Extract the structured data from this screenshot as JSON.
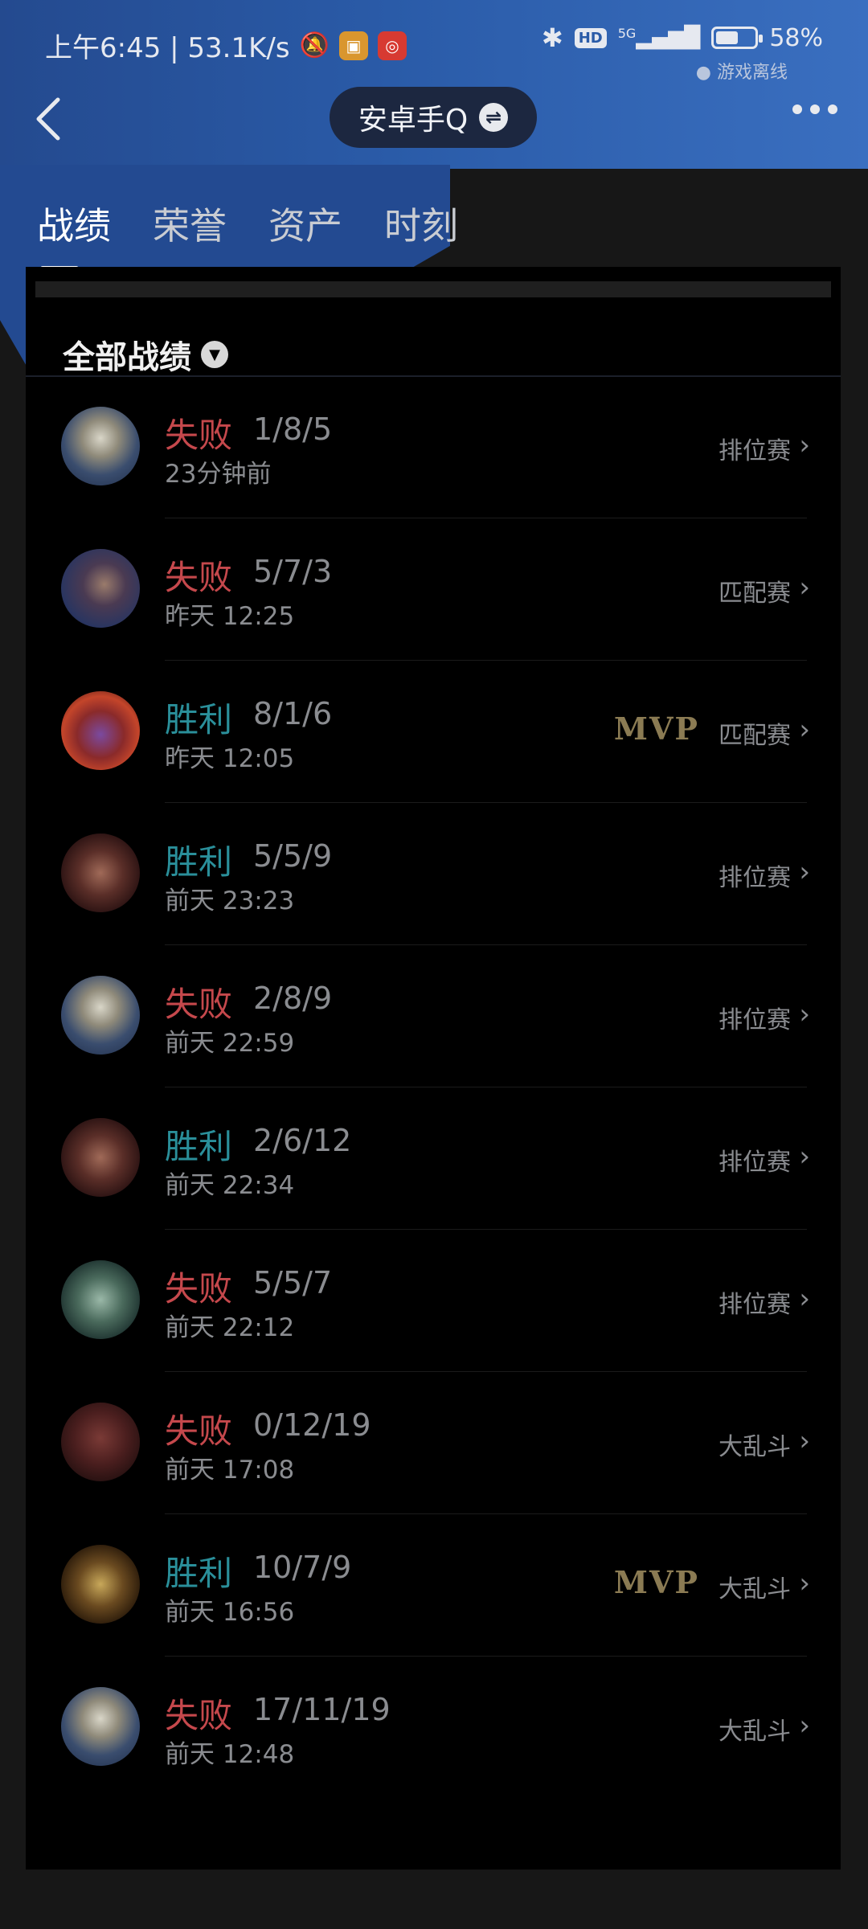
{
  "status": {
    "time": "上午6:45 | 53.1K/s",
    "network_type": "5G",
    "hd_label": "HD",
    "battery": "58%",
    "battery_level": 0.58,
    "offline_text": "● 游戏离线"
  },
  "nav": {
    "title": "安卓手Q"
  },
  "tabs": [
    {
      "label": "战绩",
      "active": true
    },
    {
      "label": "荣誉",
      "active": false
    },
    {
      "label": "资产",
      "active": false
    },
    {
      "label": "时刻",
      "active": false
    }
  ],
  "section": {
    "title": "全部战绩"
  },
  "matches": [
    {
      "result": "失败",
      "win": false,
      "kda": "1/8/5",
      "time": "23分钟前",
      "mode": "排位赛",
      "mvp": "",
      "avatar": "silver-helmet"
    },
    {
      "result": "失败",
      "win": false,
      "kda": "5/7/3",
      "time": "昨天 12:25",
      "mode": "匹配赛",
      "mvp": "",
      "avatar": "yasuo"
    },
    {
      "result": "胜利",
      "win": true,
      "kda": "8/1/6",
      "time": "昨天 12:05",
      "mode": "匹配赛",
      "mvp": "MVP",
      "avatar": "red-purple"
    },
    {
      "result": "胜利",
      "win": true,
      "kda": "5/5/9",
      "time": "前天 23:23",
      "mode": "排位赛",
      "mvp": "",
      "avatar": "darius"
    },
    {
      "result": "失败",
      "win": false,
      "kda": "2/8/9",
      "time": "前天 22:59",
      "mode": "排位赛",
      "mvp": "",
      "avatar": "silver-helmet"
    },
    {
      "result": "胜利",
      "win": true,
      "kda": "2/6/12",
      "time": "前天 22:34",
      "mode": "排位赛",
      "mvp": "",
      "avatar": "darius"
    },
    {
      "result": "失败",
      "win": false,
      "kda": "5/5/7",
      "time": "前天 22:12",
      "mode": "排位赛",
      "mvp": "",
      "avatar": "green-beast"
    },
    {
      "result": "失败",
      "win": false,
      "kda": "0/12/19",
      "time": "前天 17:08",
      "mode": "大乱斗",
      "mvp": "",
      "avatar": "dark-red"
    },
    {
      "result": "胜利",
      "win": true,
      "kda": "10/7/9",
      "time": "前天 16:56",
      "mode": "大乱斗",
      "mvp": "MVP",
      "avatar": "croc"
    },
    {
      "result": "失败",
      "win": false,
      "kda": "17/11/19",
      "time": "前天 12:48",
      "mode": "大乱斗",
      "mvp": "",
      "avatar": "silver-helmet"
    }
  ]
}
